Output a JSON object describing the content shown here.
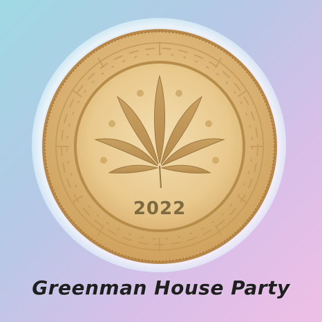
{
  "coin": {
    "year": "2022",
    "colors": {
      "gold": "#e8c98a",
      "gold_dark": "#b88d4a",
      "rim": "#d9b475",
      "edge": "#a7783a",
      "leaf": "#c9a566"
    }
  },
  "caption": {
    "text": "Greenman House Party"
  },
  "background": {
    "colors": [
      "#9fd9e4",
      "#efbfe6"
    ]
  },
  "icons": [
    "cannabis-leaf-icon",
    "circuit-pattern-icon"
  ]
}
